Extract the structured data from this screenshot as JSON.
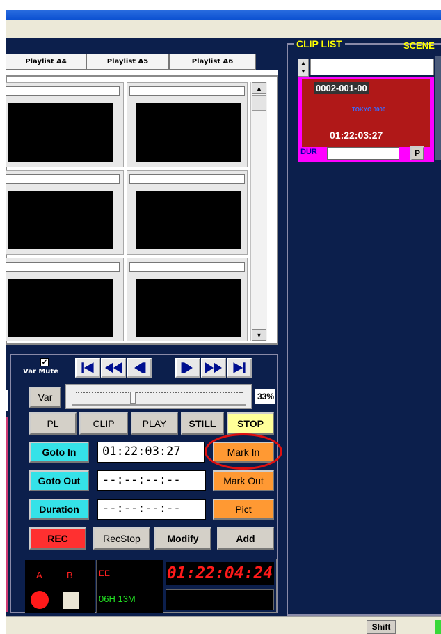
{
  "tabs": [
    "Playlist A4",
    "Playlist A5",
    "Playlist A6"
  ],
  "clip_list": {
    "title": "CLIP LIST",
    "scene_label": "SCENE",
    "clip_id": "0002-001-00",
    "clip_caption": "TOKYO 0000",
    "clip_timecode": "01:22:03:27",
    "dur_label": "DUR",
    "p_button": "P"
  },
  "transport": {
    "var_mute_label": "Var Mute",
    "var_mute_checked": true,
    "var_button": "Var",
    "speed_percent": "33%",
    "slider_value": 0.35
  },
  "mode_buttons": [
    "PL",
    "CLIP",
    "PLAY",
    "STILL",
    "STOP"
  ],
  "timecodes": {
    "goto_in_label": "Goto In",
    "in_value": "01:22:03:27",
    "mark_in_label": "Mark In",
    "goto_out_label": "Goto Out",
    "out_value": "--:--:--:--",
    "mark_out_label": "Mark Out",
    "duration_label": "Duration",
    "duration_value": "--:--:--:--",
    "pict_label": "Pict"
  },
  "actions": {
    "rec": "REC",
    "recstop": "RecStop",
    "modify": "Modify",
    "add": "Add"
  },
  "status": {
    "channel_a": "A",
    "channel_b": "B",
    "ee_label": "EE",
    "led_timecode": "01:22:04:24",
    "remaining": "06H 13M"
  },
  "statusbar": {
    "shift_label": "Shift"
  },
  "colors": {
    "app_bg": "#0c1f4c",
    "clip_border": "#ff00ff",
    "clip_thumb": "#b01818",
    "cyan_button": "#35e2e8",
    "orange_button": "#ff9933",
    "rec_button": "#ff3030",
    "stop_button": "#ffff99",
    "highlight_circle": "#e01010"
  }
}
